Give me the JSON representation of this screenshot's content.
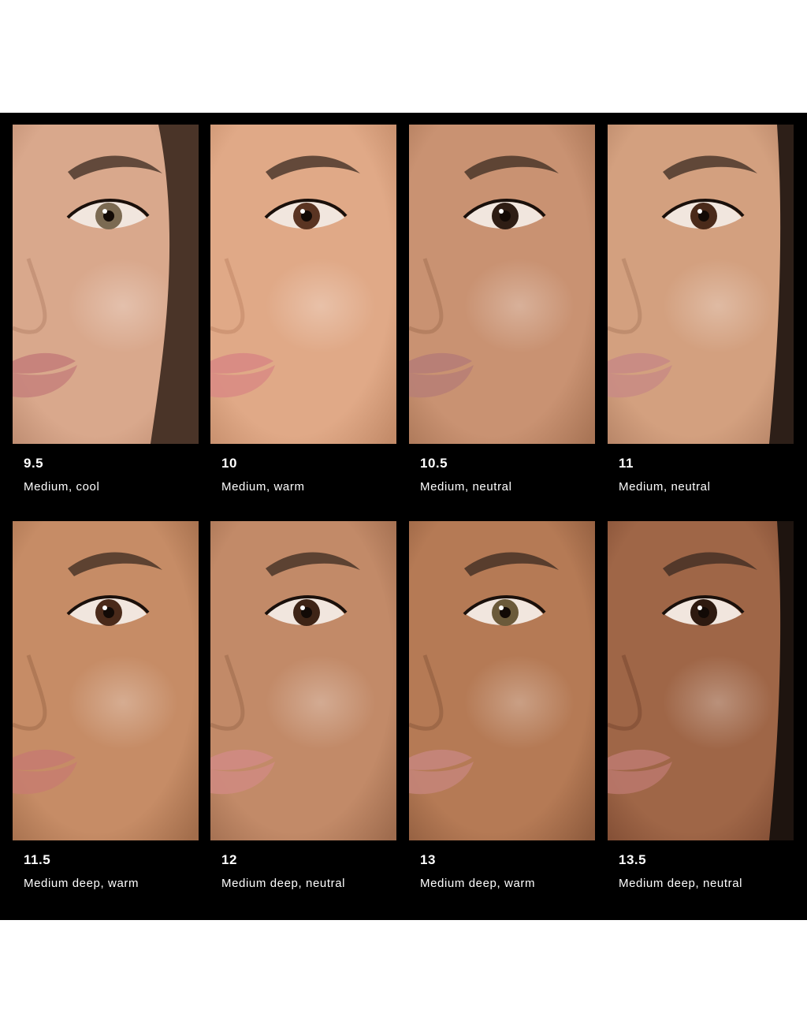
{
  "tiles": [
    {
      "shade": "9.5",
      "description": "Medium, cool",
      "skin": "#d9a88c",
      "skin_dark": "#b9876c",
      "lip": "#c7837c",
      "hair": "#4a3428",
      "iris": "#7b6a52"
    },
    {
      "shade": "10",
      "description": "Medium, warm",
      "skin": "#e0a987",
      "skin_dark": "#c38b69",
      "lip": "#d98c84",
      "hair": "",
      "iris": "#5a3422"
    },
    {
      "shade": "10.5",
      "description": "Medium, neutral",
      "skin": "#c99272",
      "skin_dark": "#a97556",
      "lip": "#b87f76",
      "hair": "",
      "iris": "#2e1d14"
    },
    {
      "shade": "11",
      "description": "Medium, neutral",
      "skin": "#d3a07f",
      "skin_dark": "#b28063",
      "lip": "#c98c84",
      "hair": "#2d1f18",
      "iris": "#4a2a1a"
    },
    {
      "shade": "11.5",
      "description": "Medium deep, warm",
      "skin": "#c68c66",
      "skin_dark": "#a26d4b",
      "lip": "#c67d6f",
      "hair": "",
      "iris": "#4a2a1a"
    },
    {
      "shade": "12",
      "description": "Medium deep, neutral",
      "skin": "#c28a68",
      "skin_dark": "#9f6c4e",
      "lip": "#cf8a80",
      "hair": "",
      "iris": "#3e2416"
    },
    {
      "shade": "13",
      "description": "Medium deep, warm",
      "skin": "#b57a55",
      "skin_dark": "#8f5c3e",
      "lip": "#c48478",
      "hair": "",
      "iris": "#6b5a3a"
    },
    {
      "shade": "13.5",
      "description": "Medium deep, neutral",
      "skin": "#9f6647",
      "skin_dark": "#7d4a32",
      "lip": "#b9776a",
      "hair": "#1e140f",
      "iris": "#2e1a10"
    }
  ]
}
